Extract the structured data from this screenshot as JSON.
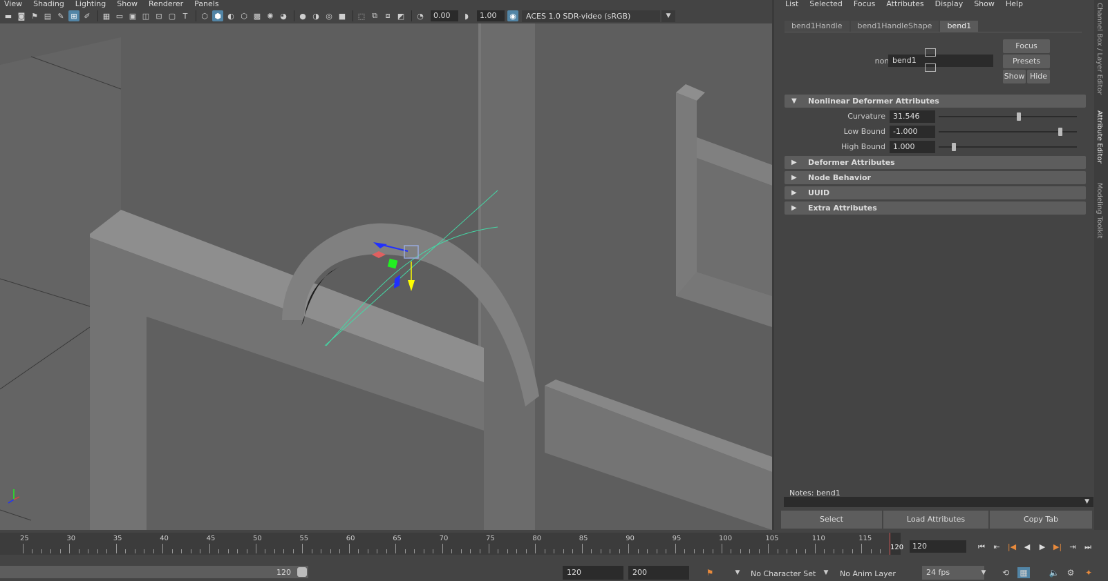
{
  "viewport": {
    "menu": [
      "View",
      "Shading",
      "Lighting",
      "Show",
      "Renderer",
      "Panels"
    ],
    "toolbar": {
      "exposure_value": "0.00",
      "gamma_value": "1.00",
      "color_management": "ACES 1.0 SDR-video (sRGB)"
    }
  },
  "attribute_editor": {
    "menu": [
      "List",
      "Selected",
      "Focus",
      "Attributes",
      "Display",
      "Show",
      "Help"
    ],
    "tabs": [
      "bend1Handle",
      "bend1HandleShape",
      "bend1"
    ],
    "active_tab": "bend1",
    "node_type_label": "nonLinear:",
    "node_name": "bend1",
    "buttons": {
      "focus": "Focus",
      "presets": "Presets",
      "show": "Show",
      "hide": "Hide"
    },
    "sections": {
      "nonlinear": "Nonlinear Deformer Attributes",
      "deformer": "Deformer Attributes",
      "node_behavior": "Node Behavior",
      "uuid": "UUID",
      "extra": "Extra Attributes"
    },
    "attributes": [
      {
        "label": "Curvature",
        "value": "31.546",
        "slider_fraction": 0.58
      },
      {
        "label": "Low Bound",
        "value": "-1.000",
        "slider_fraction": 0.88
      },
      {
        "label": "High Bound",
        "value": "1.000",
        "slider_fraction": 0.11
      }
    ],
    "notes_label": "Notes:",
    "notes_node": "bend1",
    "bottom_buttons": {
      "select": "Select",
      "load": "Load Attributes",
      "copy": "Copy Tab"
    }
  },
  "side_tabs": [
    "Channel Box / Layer Editor",
    "Attribute Editor",
    "Modeling Toolkit"
  ],
  "timeline": {
    "tick_labels": [
      "25",
      "30",
      "35",
      "40",
      "45",
      "50",
      "55",
      "60",
      "65",
      "70",
      "75",
      "80",
      "85",
      "90",
      "95",
      "100",
      "105",
      "110",
      "115"
    ],
    "end_marker": "120",
    "current_frame": "120"
  },
  "range": {
    "range_end": "120",
    "anim_end": "120",
    "playback_end": "200",
    "character_set": "No Character Set",
    "anim_layer": "No Anim Layer",
    "fps": "24 fps"
  },
  "colors": {
    "accent": "#5285a6",
    "deformer_curve": "#44d9a6",
    "handle_yellow": "#ffff00",
    "handle_green": "#22ee22",
    "handle_red": "#e06060"
  }
}
